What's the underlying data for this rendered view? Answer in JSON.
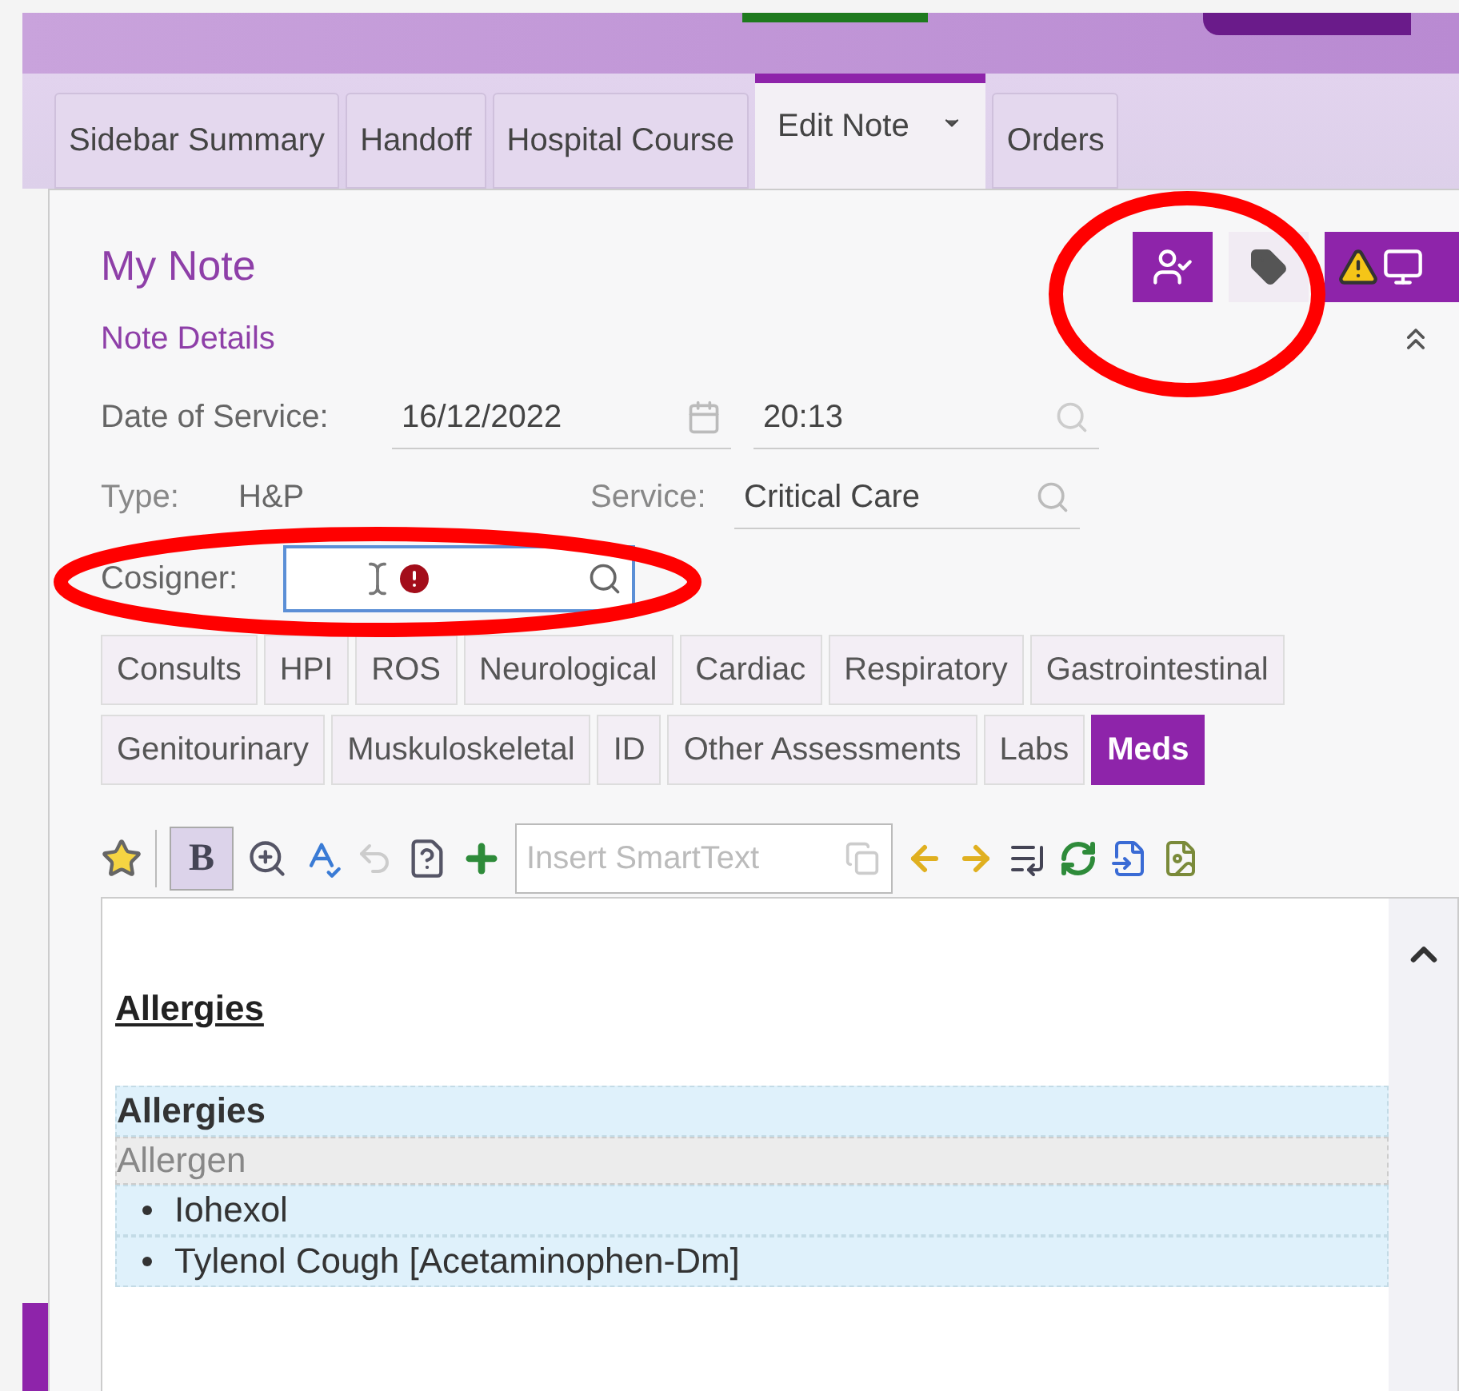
{
  "tabs": [
    {
      "label": "Sidebar Summary",
      "selected": false,
      "menu": false
    },
    {
      "label": "Handoff",
      "selected": false,
      "menu": false
    },
    {
      "label": "Hospital Course",
      "selected": false,
      "menu": false
    },
    {
      "label": "Edit Note",
      "selected": true,
      "menu": true
    },
    {
      "label": "Orders",
      "selected": false,
      "menu": false
    }
  ],
  "note": {
    "title": "My Note",
    "actions": [
      {
        "kind": "sign",
        "active": true
      },
      {
        "kind": "tag",
        "active": false
      },
      {
        "kind": "alert",
        "active": true
      }
    ],
    "details_title": "Note Details",
    "date": {
      "label": "Date of Service:",
      "value": "16/12/2022",
      "time": "20:13"
    },
    "type": {
      "label": "Type:",
      "value": "H&P"
    },
    "service": {
      "label": "Service:",
      "value": "Critical Care"
    },
    "cosigner": {
      "label": "Cosigner:",
      "focused": true,
      "error": true
    },
    "sections": [
      [
        {
          "label": "Consults",
          "selected": false
        },
        {
          "label": "HPI",
          "selected": false
        },
        {
          "label": "ROS",
          "selected": false
        },
        {
          "label": "Neurological",
          "selected": false
        },
        {
          "label": "Cardiac",
          "selected": false
        },
        {
          "label": "Respiratory",
          "selected": false
        },
        {
          "label": "Gastrointestinal",
          "selected": false
        }
      ],
      [
        {
          "label": "Genitourinary",
          "selected": false
        },
        {
          "label": "Muskuloskeletal",
          "selected": false
        },
        {
          "label": "ID",
          "selected": false
        },
        {
          "label": "Other Assessments",
          "selected": false
        },
        {
          "label": "Labs",
          "selected": false
        },
        {
          "label": "Meds",
          "selected": true
        }
      ]
    ],
    "toolbar": {
      "bold_label": "B",
      "bold_on": true,
      "undo_disabled": true,
      "smarttext_placeholder": "Insert SmartText"
    },
    "editor": {
      "heading": "Allergies",
      "table": {
        "title": "Allergies",
        "column": "Allergen",
        "rows": [
          "Iohexol",
          "Tylenol Cough [Acetaminophen-Dm]"
        ]
      }
    }
  }
}
